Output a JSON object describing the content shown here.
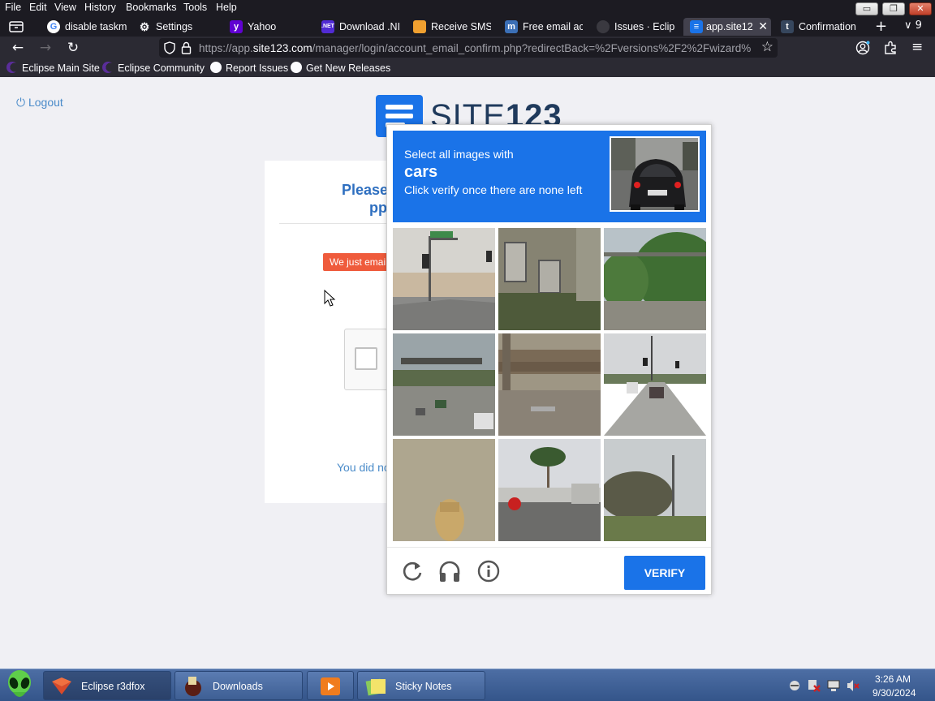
{
  "menubar": {
    "items": [
      "File",
      "Edit",
      "View",
      "History",
      "Bookmarks",
      "Tools",
      "Help"
    ]
  },
  "tabs": [
    {
      "label": "disable taskm",
      "icon": "google-icon"
    },
    {
      "label": "Settings",
      "icon": "gear-icon"
    },
    {
      "label": "Yahoo",
      "icon": "yahoo-icon"
    },
    {
      "label": "Download .NI",
      "icon": "dotnet-icon"
    },
    {
      "label": "Receive SMS (",
      "icon": "sms-icon"
    },
    {
      "label": "Free email acc",
      "icon": "mail-icon"
    },
    {
      "label": "Issues · Eclips",
      "icon": "github-icon"
    },
    {
      "label": "app.site12",
      "icon": "site123-icon",
      "active": true
    },
    {
      "label": "Confirmation",
      "icon": "tumblr-icon"
    }
  ],
  "tab_overflow_count": "9",
  "url": {
    "prefix": "https://app.",
    "domain": "site123.com",
    "path": "/manager/login/account_email_confirm.php?redirectBack=%2Fversions%2F2%2Fwizard%"
  },
  "bookmarks": [
    {
      "label": "Eclipse Main Site",
      "icon": "eclipse-icon"
    },
    {
      "label": "Eclipse Community",
      "icon": "eclipse-icon"
    },
    {
      "label": "Report Issues",
      "icon": "github-icon"
    },
    {
      "label": "Get New Releases",
      "icon": "github-icon"
    }
  ],
  "page": {
    "logout": "Logout",
    "logo_text_light": "SITE",
    "logo_text_bold": "123",
    "card_title_line1": "Please",
    "card_title_line2": "pp",
    "alert_text": "We just emai",
    "resend_text": "You did no"
  },
  "captcha": {
    "line1": "Select all images with",
    "keyword": "cars",
    "line2": "Click verify once there are none left",
    "verify_label": "VERIFY",
    "tiles": [
      "traffic-light-intersection",
      "building-wall",
      "trees-with-sign",
      "highway-with-cars",
      "overpass-bridge",
      "road-with-cars",
      "fire-hydrant",
      "street-with-palm",
      "roadside-trees"
    ]
  },
  "taskbar": {
    "buttons": [
      {
        "label": "Eclipse r3dfox",
        "icon": "firefox-icon",
        "active": true
      },
      {
        "label": "Downloads",
        "icon": "folder-icon"
      },
      {
        "label": "",
        "icon": "media-player-icon"
      },
      {
        "label": "Sticky Notes",
        "icon": "sticky-notes-icon"
      }
    ],
    "time": "3:26 AM",
    "date": "9/30/2024"
  },
  "colors": {
    "accent": "#1a73e8",
    "alert": "#ef5b3c",
    "link": "#4a8bc9"
  }
}
